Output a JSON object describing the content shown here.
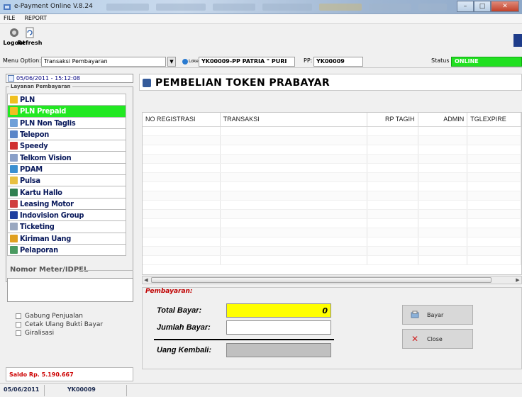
{
  "window": {
    "title": "e-Payment Online V.8.24",
    "colors": {
      "accent_green": "#22e822",
      "yellow_field": "#ffff00",
      "saldo_red": "#cc0000"
    }
  },
  "menubar": {
    "items": [
      "FILE",
      "REPORT"
    ]
  },
  "toolbar": {
    "logout_label": "Logout",
    "refresh_label": "Refresh"
  },
  "options": {
    "menu_option_label": "Menu Option:",
    "menu_option_value": "Transaksi Pembayaran",
    "loket_label": "Loket",
    "loket_value": "YK00009-PP PATRIA \" PURI",
    "pp_label": "PP:",
    "pp_value": "YK00009",
    "status_label": "Status",
    "status_value": "ONLINE"
  },
  "left": {
    "datetime": "05/06/2011 - 15:12:08",
    "layanan_legend": "Layanan Pembayaran",
    "services": [
      {
        "name": "PLN",
        "icon": "pln-icon",
        "color": "#f0c020"
      },
      {
        "name": "PLN Prepaid",
        "icon": "pln-prepaid-icon",
        "color": "#f0c020",
        "active": true
      },
      {
        "name": "PLN Non Taglis",
        "icon": "pln-nontaglis-icon",
        "color": "#6fa0d8"
      },
      {
        "name": "Telepon",
        "icon": "telepon-icon",
        "color": "#5a86c8"
      },
      {
        "name": "Speedy",
        "icon": "speedy-icon",
        "color": "#d03030"
      },
      {
        "name": "Telkom Vision",
        "icon": "telkom-vision-icon",
        "color": "#8aa0c8"
      },
      {
        "name": "PDAM",
        "icon": "pdam-icon",
        "color": "#3a8fd0"
      },
      {
        "name": "Pulsa",
        "icon": "pulsa-icon",
        "color": "#e8c040"
      },
      {
        "name": "Kartu Hallo",
        "icon": "kartu-hallo-icon",
        "color": "#308050"
      },
      {
        "name": "Leasing Motor",
        "icon": "leasing-motor-icon",
        "color": "#d04040"
      },
      {
        "name": "Indovision Group",
        "icon": "indovision-icon",
        "color": "#2040a0"
      },
      {
        "name": "Ticketing",
        "icon": "ticketing-icon",
        "color": "#9aa8c0"
      },
      {
        "name": "Kiriman Uang",
        "icon": "kiriman-uang-icon",
        "color": "#e0a020"
      },
      {
        "name": "Pelaporan",
        "icon": "pelaporan-icon",
        "color": "#4a9a60"
      }
    ],
    "meter_legend": "Nomor Meter/IDPEL",
    "meter_value": "",
    "checkboxes": [
      "Gabung Penjualan",
      "Cetak Ulang Bukti Bayar",
      "Giralisasi"
    ],
    "saldo": "Saldo Rp.  5.190.667"
  },
  "main": {
    "title": "PEMBELIAN TOKEN PRABAYAR",
    "columns": [
      "NO REGISTRASI",
      "TRANSAKSI",
      "RP TAGIH",
      "ADMIN",
      "TGLEXPIRE"
    ],
    "payment": {
      "legend": "Pembayaran:",
      "total_label": "Total Bayar:",
      "total_value": "0",
      "jumlah_label": "Jumlah Bayar:",
      "jumlah_value": "",
      "kembali_label": "Uang Kembali:",
      "kembali_value": "",
      "bayar_label": "Bayar",
      "close_label": "Close"
    }
  },
  "statusbar": {
    "date": "05/06/2011",
    "user": "YK00009"
  }
}
